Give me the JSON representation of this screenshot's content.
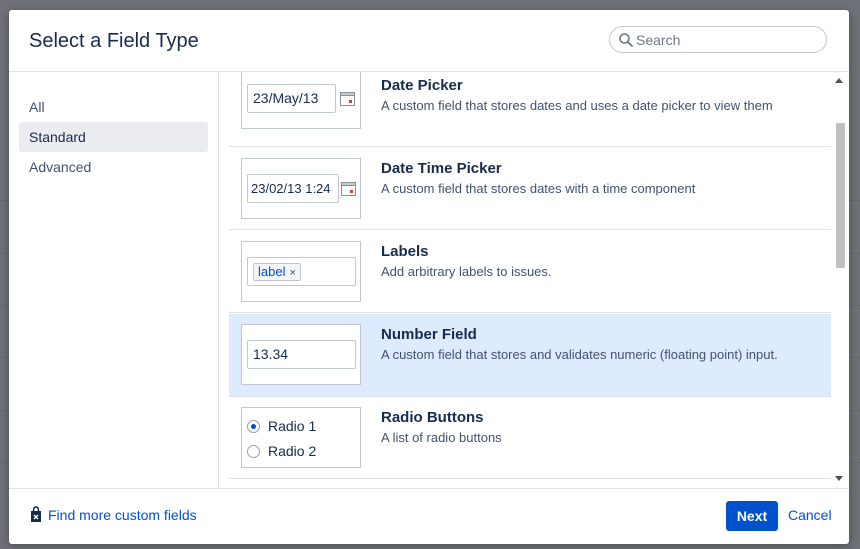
{
  "dialog": {
    "title": "Select a Field Type",
    "search_placeholder": "Search"
  },
  "sidebar": {
    "items": [
      {
        "label": "All",
        "selected": false
      },
      {
        "label": "Standard",
        "selected": true
      },
      {
        "label": "Advanced",
        "selected": false
      }
    ]
  },
  "fields": [
    {
      "name": "Date Picker",
      "description": "A custom field that stores dates and uses a date picker to view them",
      "preview_value": "23/May/13",
      "preview_icon": "calendar-icon"
    },
    {
      "name": "Date Time Picker",
      "description": "A custom field that stores dates with a time component",
      "preview_value": "23/02/13 1:24",
      "preview_icon": "calendar-icon"
    },
    {
      "name": "Labels",
      "description": "Add arbitrary labels to issues.",
      "preview_chip": "label",
      "chip_remove": "×"
    },
    {
      "name": "Number Field",
      "description": "A custom field that stores and validates numeric (floating point) input.",
      "preview_value": "13.34",
      "selected": true
    },
    {
      "name": "Radio Buttons",
      "description": "A list of radio buttons",
      "radio_options": [
        {
          "label": "Radio 1",
          "checked": true
        },
        {
          "label": "Radio 2",
          "checked": false
        }
      ]
    }
  ],
  "footer": {
    "find_more": "Find more custom fields",
    "next_label": "Next",
    "cancel_label": "Cancel"
  },
  "colors": {
    "accent": "#0052cc",
    "selected_row": "#deebff",
    "sidebar_selected": "#ebecf0",
    "backdrop": "#6f7278"
  }
}
